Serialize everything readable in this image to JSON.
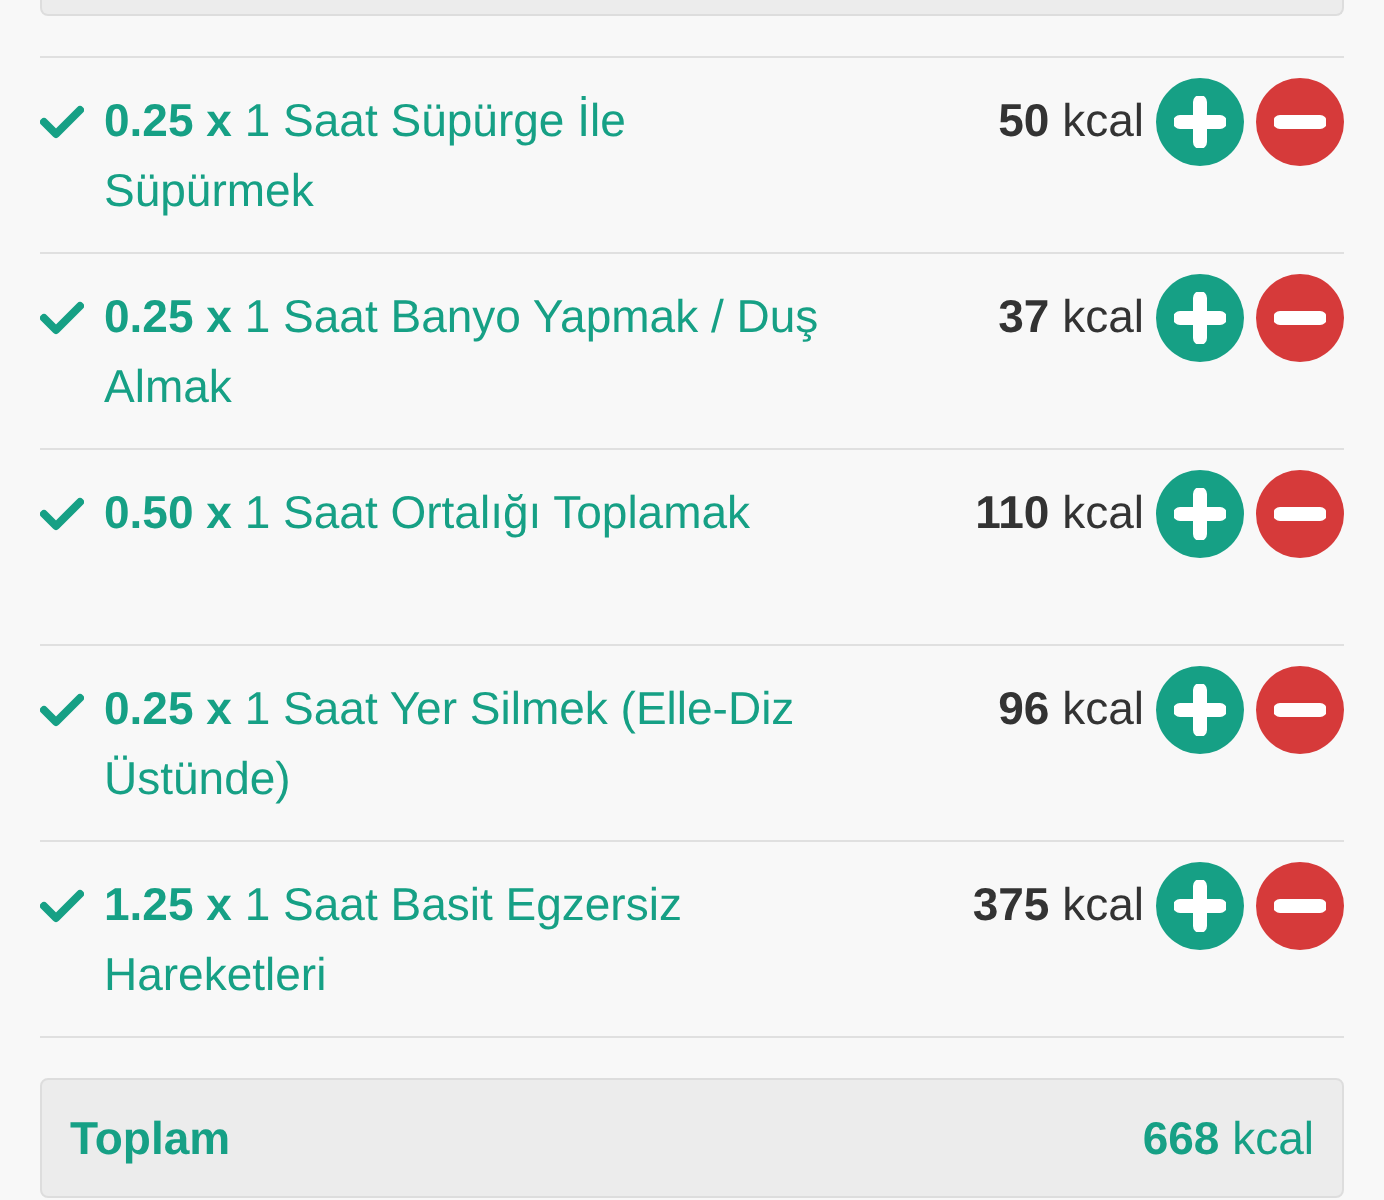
{
  "activities": [
    {
      "text": "**0.25 x** 1 Saat Süpürge İle Süpürmek",
      "kcal": "**50** kcal"
    },
    {
      "text": "**0.25 x** 1 Saat Banyo Yapmak / Duş Almak",
      "kcal": "**37** kcal"
    },
    {
      "text": "**0.50 x** 1 Saat Ortalığı Toplamak",
      "kcal": "**110** kcal"
    },
    {
      "text": "**0.25 x** 1 Saat Yer Silmek (Elle-Diz Üstünde)",
      "kcal": "**96** kcal"
    },
    {
      "text": "**1.25 x** 1 Saat Basit Egzersiz Hareketleri",
      "kcal": "**375** kcal"
    }
  ],
  "total": {
    "label": "Toplam",
    "value": "**668** kcal"
  }
}
